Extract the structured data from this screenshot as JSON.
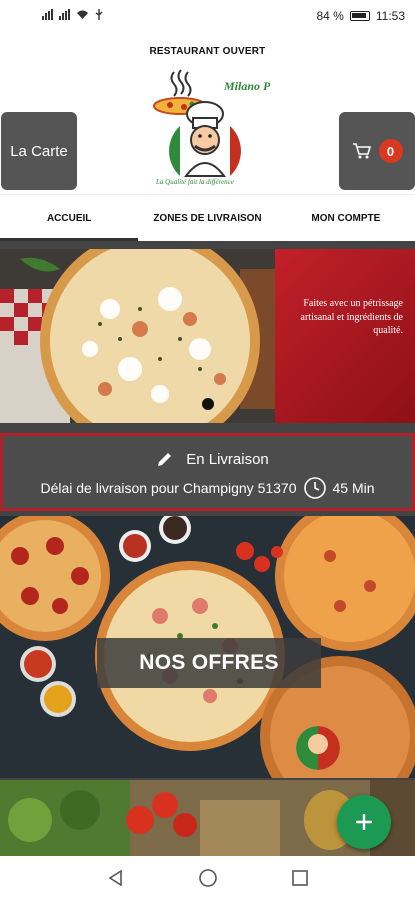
{
  "status_bar": {
    "battery": "84 %",
    "time": "11:53"
  },
  "header": {
    "restaurant_status": "RESTAURANT OUVERT",
    "menu_button": "La Carte",
    "cart_count": "0",
    "logo_name": "Milano Pizza",
    "logo_slogan": "La Qualité fait la différence"
  },
  "tabs": [
    {
      "label": "ACCUEIL",
      "active": true
    },
    {
      "label": "ZONES DE LIVRAISON",
      "active": false
    },
    {
      "label": "MON COMPTE",
      "active": false
    }
  ],
  "banner": {
    "text": "Faites avec un pétrissage artisanal et ingrédients de qualité."
  },
  "delivery": {
    "mode": "En Livraison",
    "delay_text": "Délai de livraison pour Champigny 51370",
    "delay_time": "45 Min"
  },
  "offers": {
    "label": "NOS OFFRES"
  },
  "colors": {
    "accent_red": "#b0212a",
    "cart_badge": "#d9391f",
    "fab_green": "#1c9a54",
    "button_gray": "#555555"
  },
  "icons": {
    "cart": "cart-icon",
    "edit": "pencil-icon",
    "clock": "clock-icon",
    "fab": "plus-icon"
  }
}
